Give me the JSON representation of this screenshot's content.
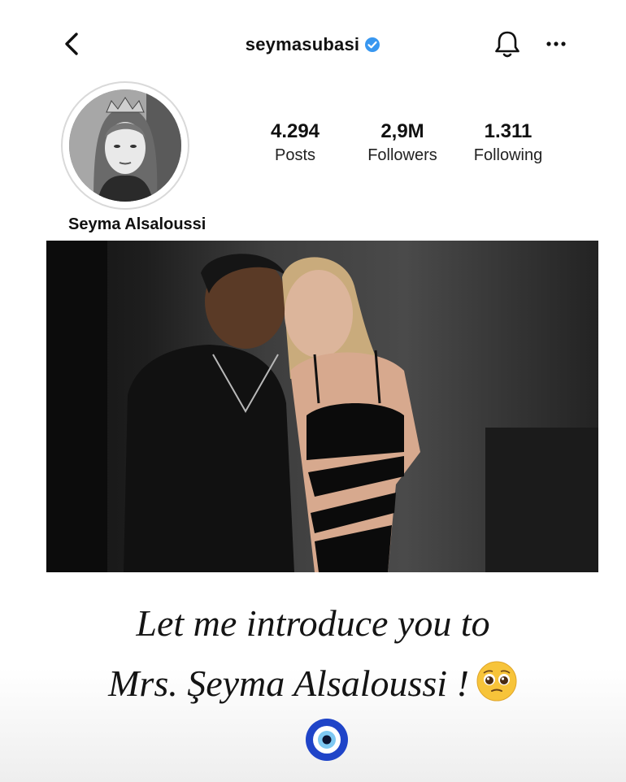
{
  "header": {
    "username": "seymasubasi",
    "icons": {
      "back": "chevron-left-icon",
      "verified": "verified-badge-icon",
      "bell": "bell-icon",
      "more": "more-icon"
    }
  },
  "profile": {
    "display_name": "Seyma Alsaloussi",
    "stats": [
      {
        "value": "4.294",
        "label": "Posts"
      },
      {
        "value": "2,9M",
        "label": "Followers"
      },
      {
        "value": "1.311",
        "label": "Following"
      }
    ]
  },
  "caption": {
    "line1": "Let me introduce you to",
    "line2": "Mrs. Şeyma Alsaloussi !"
  },
  "colors": {
    "verified": "#3897f0",
    "text": "#111111"
  }
}
